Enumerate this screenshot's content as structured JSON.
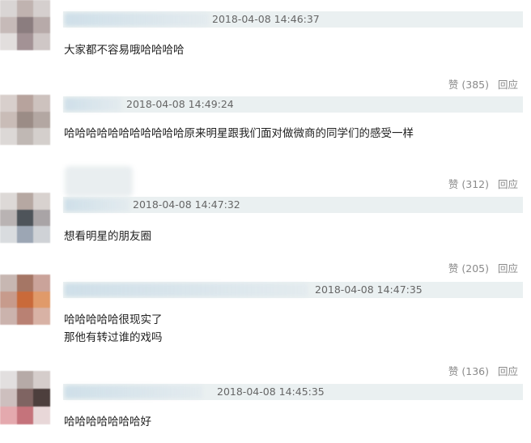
{
  "comments": [
    {
      "text": "大家都不容易哦哈哈哈哈",
      "time": "2018-04-08 14:46:37",
      "likes_label": "赞 (385)",
      "reply_label": "回应"
    },
    {
      "text": "哈哈哈哈哈哈哈哈哈哈哈原来明星跟我们面对做微商的同学们的感受一样",
      "time": "2018-04-08 14:49:24",
      "likes_label": "赞 (312)",
      "reply_label": "回应"
    },
    {
      "text": "想看明星的朋友圈",
      "time": "2018-04-08 14:47:32",
      "likes_label": "赞 (205)",
      "reply_label": "回应"
    },
    {
      "text": "哈哈哈哈哈很现实了",
      "text2": "那他有转过谁的戏吗",
      "time": "2018-04-08 14:47:35",
      "likes_label": "赞 (136)",
      "reply_label": "回应"
    },
    {
      "text": "哈哈哈哈哈哈哈好",
      "time": "2018-04-08 14:45:35"
    }
  ]
}
